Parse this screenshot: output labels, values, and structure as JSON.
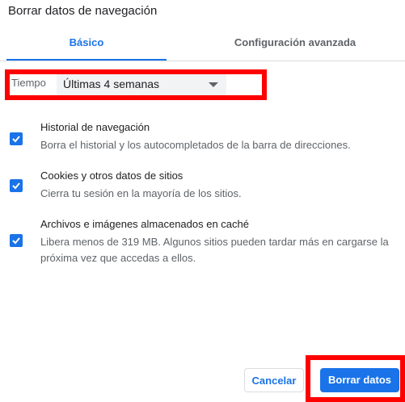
{
  "dialog": {
    "title": "Borrar datos de navegación"
  },
  "tabs": [
    {
      "label": "Básico",
      "selected": true
    },
    {
      "label": "Configuración avanzada",
      "selected": false
    }
  ],
  "time_range": {
    "label": "Tiempo",
    "value": "Últimas 4 semanas"
  },
  "items": [
    {
      "title": "Historial de navegación",
      "description": "Borra el historial y los autocompletados de la barra de direcciones.",
      "checked": true
    },
    {
      "title": "Cookies y otros datos de sitios",
      "description": "Cierra tu sesión en la mayoría de los sitios.",
      "checked": true
    },
    {
      "title": "Archivos e imágenes almacenados en caché",
      "description": "Libera menos de 319 MB. Algunos sitios pueden tardar más en cargarse la próxima vez que accedas a ellos.",
      "checked": true
    }
  ],
  "buttons": {
    "cancel": "Cancelar",
    "clear": "Borrar datos"
  },
  "colors": {
    "accent": "#1a73e8",
    "annotation": "#ff0000"
  }
}
